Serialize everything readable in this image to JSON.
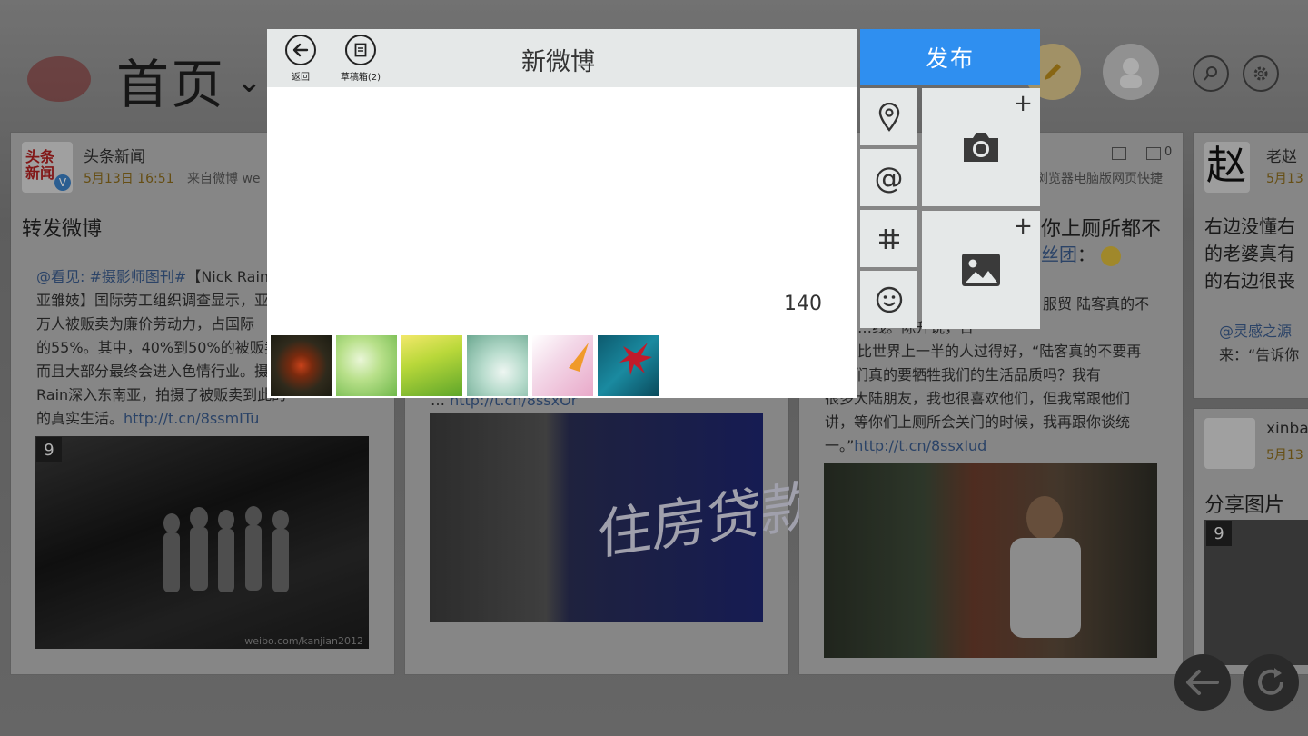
{
  "header": {
    "title": "首页"
  },
  "cards": [
    {
      "name": "头条新闻",
      "time": "5月13日 16:51",
      "source": "来自微博 we",
      "heading": "转发微博",
      "mention": "@看见",
      "tag": ": #摄影师图刊#",
      "body_line1_rest": "【Nick Rain：",
      "body_line2": "亚雏妓】国际劳工组织调查显示，亚",
      "body_line3": "万人被贩卖为廉价劳动力，占国际",
      "body_line4": "的55%。其中，40%到50%的被贩卖",
      "body_line5": "而且大部分最终会进入色情行业。摄",
      "body_line6": "Rain深入东南亚，拍摄了被贩卖到此的",
      "body_line7": "的真实生活。",
      "link": "http://t.cn/8ssmITu",
      "photo_count": "9",
      "watermark": "weibo.com/kanjian2012"
    },
    {
      "photo_text": "住房贷款",
      "link_partial": "http://t.cn/8ssxOr"
    },
    {
      "heading_partial": "你上厕所都不",
      "fans_link": "丝团",
      "line1": "服贸 陆客真的不",
      "line2": "…线。”陈升说，台",
      "line3": "比世界上一半的人过得好，“陆客真的不要再",
      "line4": "，我们真的要牺牲我们的生活品质吗？我有",
      "line5": "很多大陆朋友，我也很喜欢他们，但我常跟他们",
      "line6": "讲，等你们上厕所会关门的时候，我再跟你谈统",
      "line7": "一。”",
      "link": "http://t.cn/8ssxIud",
      "stats_comment": "0",
      "sub_line": "浏览器电脑版网页快捷"
    },
    {
      "name": "老赵",
      "avatar_char": "赵",
      "time": "5月13",
      "body_line1": "右边没懂右",
      "body_line2": "的老婆真有",
      "body_line3": "的右边很丧",
      "mention": "@灵感之源",
      "quote": "来：“告诉你"
    },
    {
      "name": "xinba",
      "time": "5月13",
      "heading": "分享图片",
      "photo_count": "9"
    }
  ],
  "compose": {
    "back_label": "返回",
    "drafts_label": "草稿箱(2)",
    "title": "新微博",
    "char_count": "140",
    "publish_label": "发布",
    "thumbnails": [
      "red-flower",
      "green-leaf",
      "yellow-green",
      "teal-mist",
      "pink-orange",
      "red-maple"
    ]
  },
  "colors": {
    "accent": "#2f8ff0",
    "toolbar": "#e5e8e8"
  }
}
